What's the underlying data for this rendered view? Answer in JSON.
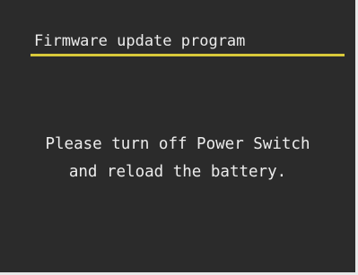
{
  "screen": {
    "title": "Firmware update program",
    "message_lines": [
      "Please turn off Power Switch",
      "and reload the battery."
    ]
  },
  "colors": {
    "background": "#2b2b2b",
    "text": "#ececec",
    "accent_underline": "#d9c93a"
  }
}
